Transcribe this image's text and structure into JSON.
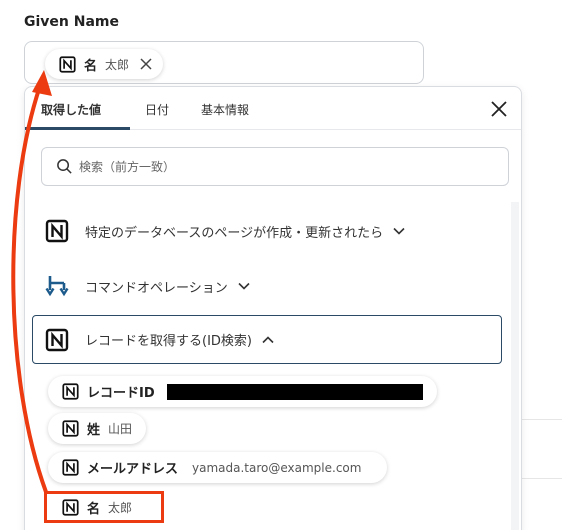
{
  "field": {
    "label": "Given Name",
    "selected_chip": {
      "glyph": "名",
      "value": "太郎"
    }
  },
  "dropdown": {
    "tabs": [
      {
        "label": "取得した値",
        "active": true
      },
      {
        "label": "日付",
        "active": false
      },
      {
        "label": "基本情報",
        "active": false
      }
    ],
    "search": {
      "placeholder": "検索（前方一致）"
    },
    "sections": [
      {
        "label": "特定のデータベースのページが作成・更新されたら",
        "icon": "notion-icon",
        "expanded": false
      },
      {
        "label": "コマンドオペレーション",
        "icon": "command-operation-icon",
        "expanded": false
      },
      {
        "label": "レコードを取得する(ID検索)",
        "icon": "notion-icon",
        "expanded": true
      }
    ],
    "values": [
      {
        "name": "レコードID",
        "value": "",
        "redacted": true
      },
      {
        "name": "姓",
        "value": "山田"
      },
      {
        "name": "メールアドレス",
        "value": "yamada.taro@example.com"
      },
      {
        "name": "名",
        "value": "太郎"
      }
    ]
  },
  "colors": {
    "accent": "#2b4a66",
    "annotation": "#ec3b10"
  }
}
